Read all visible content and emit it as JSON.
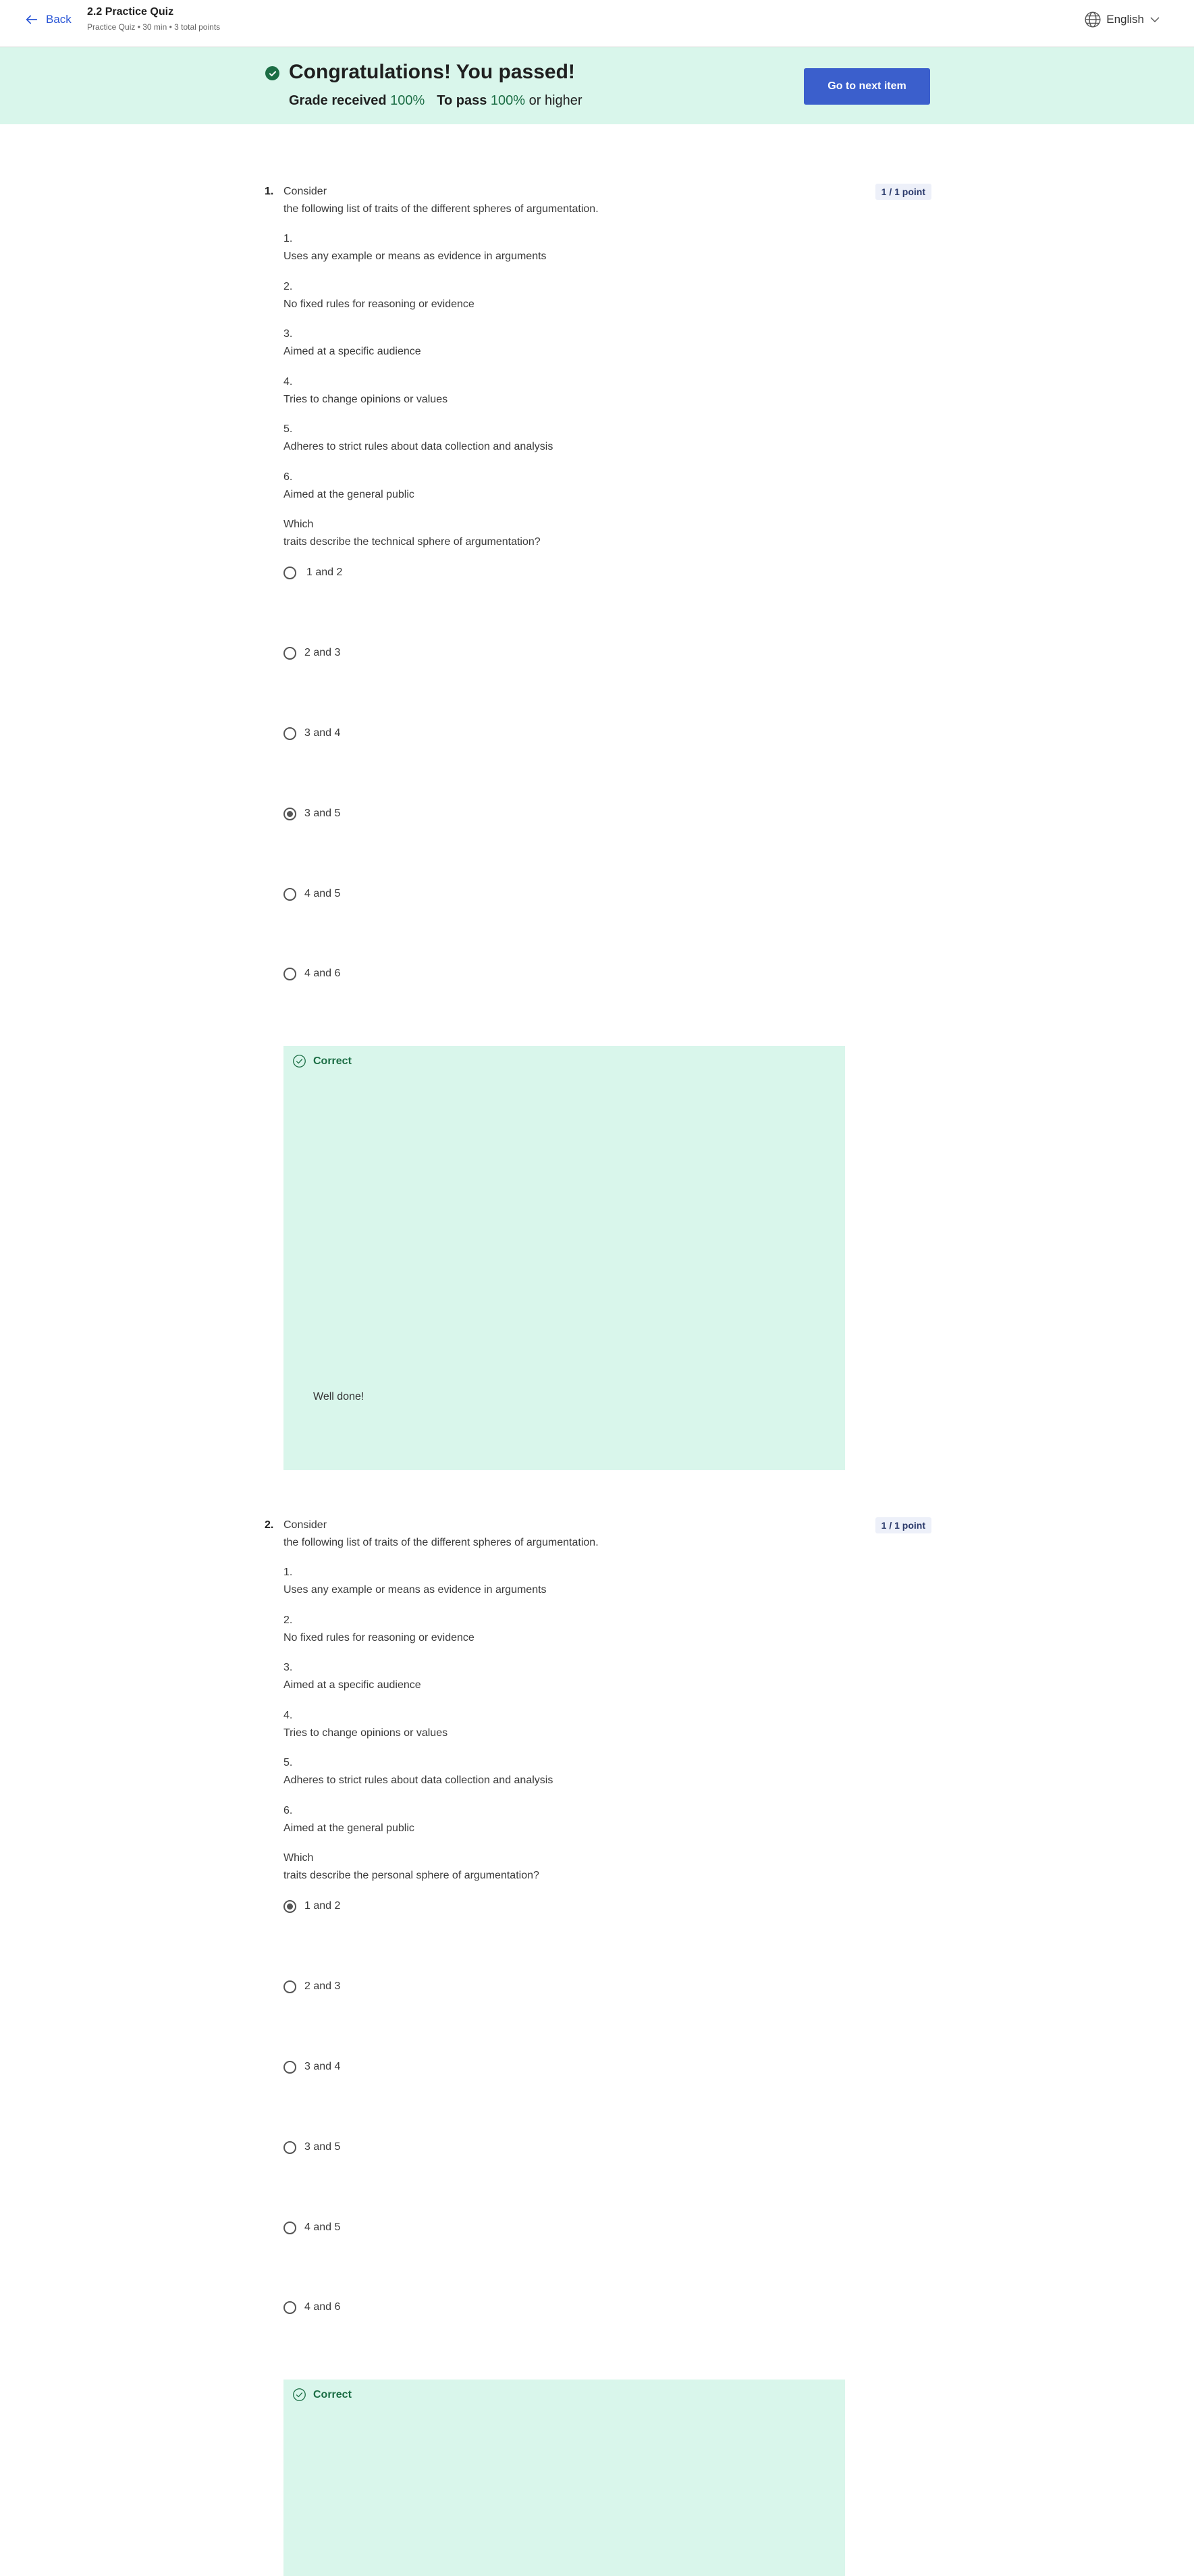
{
  "header": {
    "back_label": "Back",
    "quiz_title": "2.2 Practice Quiz",
    "quiz_meta": "Practice Quiz • 30 min • 3 total points",
    "language": "English"
  },
  "banner": {
    "title": "Congratulations! You passed!",
    "grade_label": "Grade received",
    "grade_value": "100%",
    "pass_label": "To pass",
    "pass_value": "100%",
    "pass_suffix": "or higher",
    "next_button": "Go to next item"
  },
  "questions": [
    {
      "number": "1.",
      "points": "1 / 1 point",
      "lines": [
        "Consider",
        "the following list of traits of the different spheres of argumentation.",
        "1.",
        "Uses any example or means as evidence in arguments",
        "2.",
        "No fixed rules for reasoning or evidence",
        "3.",
        "Aimed at a specific audience",
        "4.",
        "Tries to change opinions or values",
        "5.",
        "Adheres to strict rules about data collection and analysis",
        "6.",
        "Aimed at the general public",
        "Which",
        "traits describe the technical sphere of argumentation?"
      ],
      "options": [
        "1 and 2",
        "2 and 3",
        "3 and 4",
        "3 and 5",
        "4 and 5",
        "4 and 6"
      ],
      "selected_option": "3 and 5",
      "feedback_label": "Correct",
      "feedback_text": "Well done!"
    },
    {
      "number": "2.",
      "points": "1 / 1 point",
      "lines": [
        "Consider",
        "the following list of traits of the different spheres of argumentation.",
        "1.",
        "Uses any example or means as evidence in arguments",
        "2.",
        "No fixed rules for reasoning or evidence",
        "3.",
        "Aimed at a specific audience",
        "4.",
        "Tries to change opinions or values",
        "5.",
        "Adheres to strict rules about data collection and analysis",
        "6.",
        "Aimed at the general public",
        "Which",
        "traits describe the personal sphere of argumentation?"
      ],
      "options": [
        "1 and 2",
        "2 and 3",
        "3 and 4",
        "3 and 5",
        "4 and 5",
        "4 and 6"
      ],
      "selected_option": "1 and 2",
      "feedback_label": "Correct",
      "feedback_text": ""
    }
  ],
  "icons": {
    "back": "arrow-left-icon",
    "language": "globe-icon",
    "dropdown": "chevron-down-icon",
    "banner_check": "check-circle-filled-icon",
    "feedback_check": "check-circle-outline-icon"
  },
  "colors": {
    "accent": "#3b5fcc",
    "link": "#2a56d6",
    "success": "#1c6e45",
    "success_bg": "#d9f6eb"
  }
}
